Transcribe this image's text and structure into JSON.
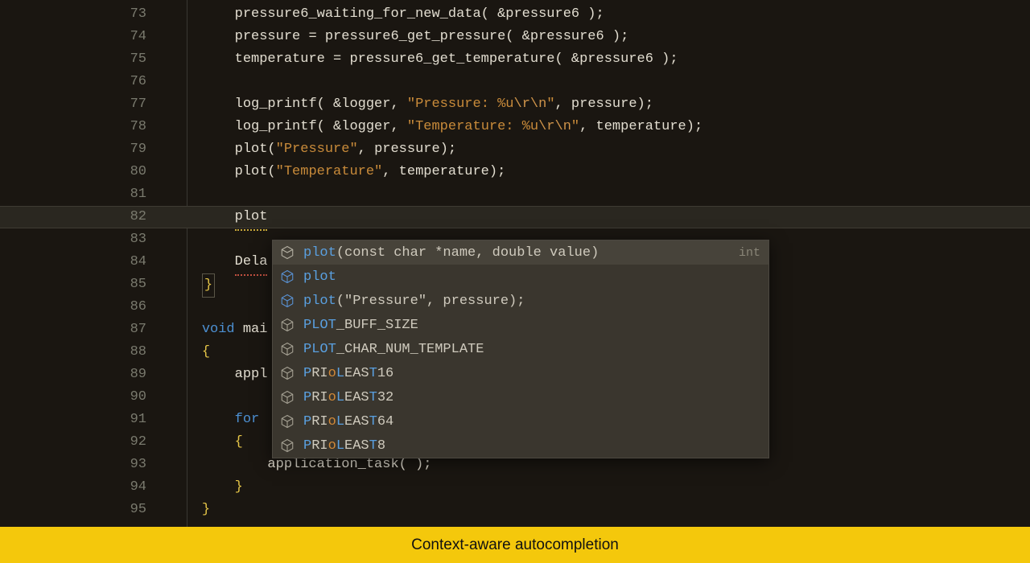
{
  "caption": "Context-aware autocompletion",
  "lines": {
    "73": "73",
    "74": "74",
    "75": "75",
    "76": "76",
    "77": "77",
    "78": "78",
    "79": "79",
    "80": "80",
    "81": "81",
    "82": "82",
    "83": "83",
    "84": "84",
    "85": "85",
    "86": "86",
    "87": "87",
    "88": "88",
    "89": "89",
    "90": "90",
    "91": "91",
    "92": "92",
    "93": "93",
    "94": "94",
    "95": "95"
  },
  "code": {
    "l73": [
      "pressure6_waiting_for_new_data( &pressure6 );"
    ],
    "l74": [
      "pressure = pressure6_get_pressure( &pressure6 );"
    ],
    "l75": [
      "temperature = pressure6_get_temperature( &pressure6 );"
    ],
    "l77_pre": "log_printf( &logger, ",
    "l77_str": "\"Pressure: %u",
    "l77_esc": "\\r\\n",
    "l77_end": "\"",
    "l77_post": ", pressure);",
    "l78_pre": "log_printf( &logger, ",
    "l78_str": "\"Temperature: %u",
    "l78_esc": "\\r\\n",
    "l78_end": "\"",
    "l78_post": ", temperature);",
    "l79_pre": "plot(",
    "l79_str": "\"Pressure\"",
    "l79_post": ", pressure);",
    "l80_pre": "plot(",
    "l80_str": "\"Temperature\"",
    "l80_post": ", temperature);",
    "l82": "plot",
    "l84": "Dela",
    "l85": "}",
    "l87_kw": "void",
    "l87_rest": " mai",
    "l88": "{",
    "l89": "appl",
    "l91_kw": "for",
    "l92": "{",
    "l93": "application_task( );",
    "l94": "}",
    "l95": "}"
  },
  "autocomplete": {
    "return_type": "int",
    "items": [
      {
        "icon": "function-outline",
        "prefix": "plot",
        "rest": "(const char *name, double value)",
        "selected": true
      },
      {
        "icon": "cube-blue",
        "prefix": "plot",
        "rest": ""
      },
      {
        "icon": "cube-blue",
        "prefix": "plot",
        "rest": "(\"Pressure\", pressure);"
      },
      {
        "icon": "cube-outline",
        "segments": [
          [
            "hl",
            "PLOT"
          ],
          [
            "plain",
            "_BUFF_SIZE"
          ]
        ]
      },
      {
        "icon": "cube-outline",
        "segments": [
          [
            "hl",
            "PLOT"
          ],
          [
            "plain",
            "_CHAR_NUM_TEMPLATE"
          ]
        ]
      },
      {
        "icon": "cube-outline",
        "segments": [
          [
            "hl",
            "P"
          ],
          [
            "plain",
            "RI"
          ],
          [
            "lo",
            "o"
          ],
          [
            "hl",
            "L"
          ],
          [
            "plain",
            "EAS"
          ],
          [
            "hl",
            "T"
          ],
          [
            "plain",
            "16"
          ]
        ]
      },
      {
        "icon": "cube-outline",
        "segments": [
          [
            "hl",
            "P"
          ],
          [
            "plain",
            "RI"
          ],
          [
            "lo",
            "o"
          ],
          [
            "hl",
            "L"
          ],
          [
            "plain",
            "EAS"
          ],
          [
            "hl",
            "T"
          ],
          [
            "plain",
            "32"
          ]
        ]
      },
      {
        "icon": "cube-outline",
        "segments": [
          [
            "hl",
            "P"
          ],
          [
            "plain",
            "RI"
          ],
          [
            "lo",
            "o"
          ],
          [
            "hl",
            "L"
          ],
          [
            "plain",
            "EAS"
          ],
          [
            "hl",
            "T"
          ],
          [
            "plain",
            "64"
          ]
        ]
      },
      {
        "icon": "cube-outline",
        "segments": [
          [
            "hl",
            "P"
          ],
          [
            "plain",
            "RI"
          ],
          [
            "lo",
            "o"
          ],
          [
            "hl",
            "L"
          ],
          [
            "plain",
            "EAS"
          ],
          [
            "hl",
            "T"
          ],
          [
            "plain",
            "8"
          ]
        ]
      }
    ]
  }
}
